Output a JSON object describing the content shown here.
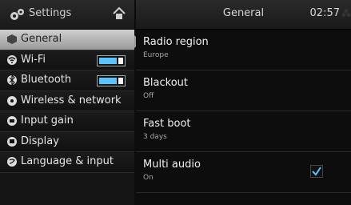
{
  "sidebar": {
    "title": "Settings",
    "items": [
      {
        "label": "General",
        "selected": true,
        "icon": "cube-icon"
      },
      {
        "label": "Wi-Fi",
        "toggle": true,
        "icon": "wifi-icon"
      },
      {
        "label": "Bluetooth",
        "toggle": true,
        "icon": "bluetooth-icon"
      },
      {
        "label": "Wireless & network",
        "icon": "network-icon"
      },
      {
        "label": "Input gain",
        "icon": "input-icon"
      },
      {
        "label": "Display",
        "icon": "display-icon"
      },
      {
        "label": "Language & input",
        "icon": "language-icon"
      }
    ]
  },
  "header": {
    "title": "General",
    "time": "02:57",
    "bluetooth_icon": "bluetooth-icon"
  },
  "settings": [
    {
      "name": "Radio region",
      "value": "Europe"
    },
    {
      "name": "Blackout",
      "value": "Off"
    },
    {
      "name": "Fast boot",
      "value": "3 days"
    },
    {
      "name": "Multi audio",
      "value": "On",
      "checkbox": true,
      "checked": true
    }
  ],
  "colors": {
    "accent": "#5bc3ff",
    "selected_bg": "#b8b8b8"
  }
}
